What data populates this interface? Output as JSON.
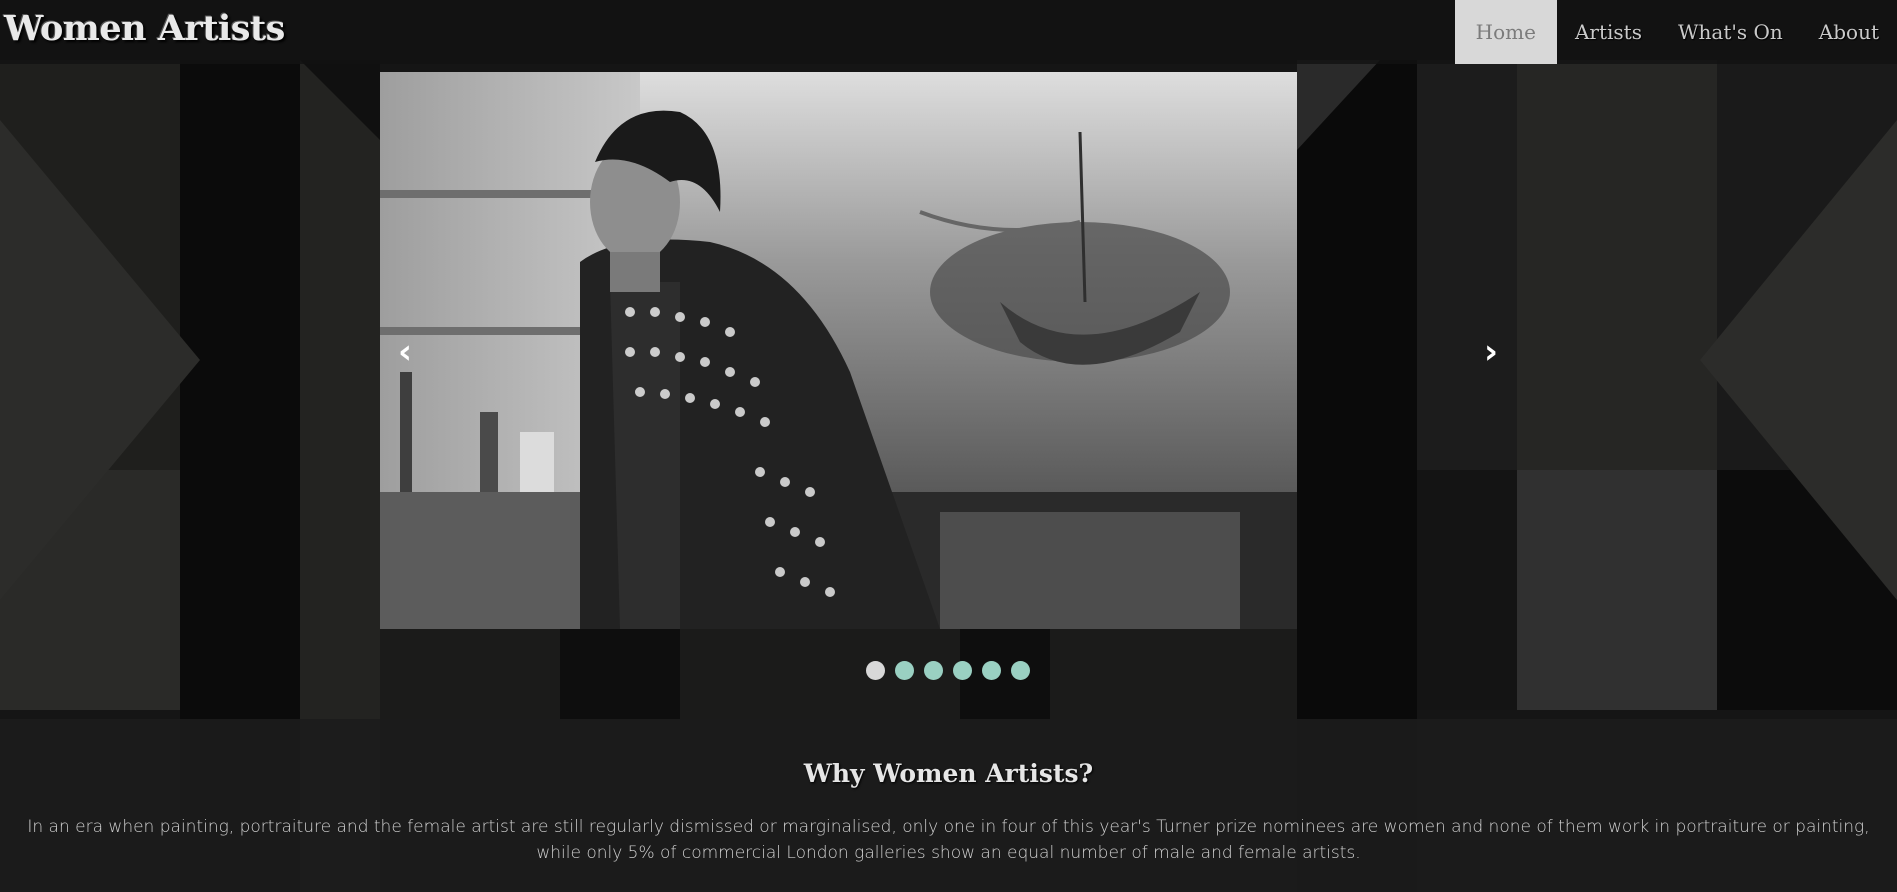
{
  "header": {
    "logo": "Women Artists",
    "nav": [
      {
        "label": "Home",
        "active": true
      },
      {
        "label": "Artists",
        "active": false
      },
      {
        "label": "What's On",
        "active": false
      },
      {
        "label": "About",
        "active": false
      }
    ]
  },
  "slider": {
    "prev_icon": "‹",
    "next_icon": "›",
    "slide_count": 6,
    "current_slide": 1,
    "dot_color": "#9ad0c2",
    "active_dot_color": "#d8d8d8"
  },
  "intro": {
    "title": "Why Women Artists?",
    "text": "In an era when painting, portraiture and the female artist are still regularly dismissed or marginalised, only one in four of this year's Turner prize nominees are women and none of them work in portraiture or painting, while only 5% of commercial London galleries show an equal number of male and female artists."
  }
}
